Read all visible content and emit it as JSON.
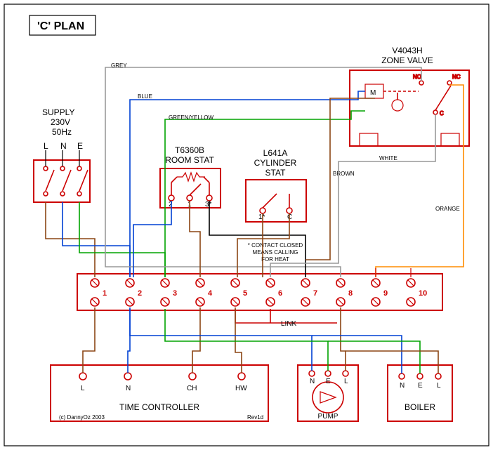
{
  "title": "'C' PLAN",
  "supply": {
    "label1": "SUPPLY",
    "label2": "230V",
    "label3": "50Hz",
    "L": "L",
    "N": "N",
    "E": "E"
  },
  "roomstat": {
    "label1": "T6360B",
    "label2": "ROOM STAT",
    "t1": "1",
    "t2": "2",
    "t3": "3*"
  },
  "cylstat": {
    "label1": "L641A",
    "label2": "CYLINDER",
    "label3": "STAT",
    "t1": "1*",
    "tc": "C",
    "note1": "* CONTACT CLOSED",
    "note2": "MEANS CALLING",
    "note3": "FOR HEAT"
  },
  "zonevalve": {
    "label1": "V4043H",
    "label2": "ZONE VALVE",
    "M": "M",
    "NO": "NO",
    "NC": "NC",
    "C": "C"
  },
  "junction": {
    "link": "LINK",
    "n1": "1",
    "n2": "2",
    "n3": "3",
    "n4": "4",
    "n5": "5",
    "n6": "6",
    "n7": "7",
    "n8": "8",
    "n9": "9",
    "n10": "10"
  },
  "timectl": {
    "label": "TIME CONTROLLER",
    "L": "L",
    "N": "N",
    "CH": "CH",
    "HW": "HW"
  },
  "pump": {
    "label": "PUMP",
    "N": "N",
    "E": "E",
    "L": "L"
  },
  "boiler": {
    "label": "BOILER",
    "N": "N",
    "E": "E",
    "L": "L"
  },
  "wirelabels": {
    "grey": "GREY",
    "blue": "BLUE",
    "greenyellow": "GREEN/YELLOW",
    "brown": "BROWN",
    "white": "WHITE",
    "orange": "ORANGE"
  },
  "footer": {
    "copy": "(c) DannyOz 2003",
    "rev": "Rev1d"
  }
}
